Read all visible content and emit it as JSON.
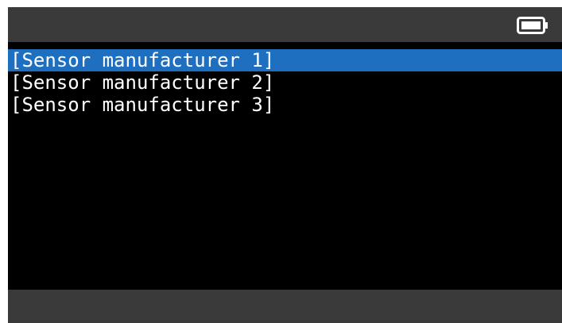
{
  "topbar": {
    "battery_icon": "battery-icon"
  },
  "list": {
    "items": [
      {
        "label": "[Sensor manufacturer 1]",
        "selected": true
      },
      {
        "label": "[Sensor manufacturer 2]",
        "selected": false
      },
      {
        "label": "[Sensor manufacturer 3]",
        "selected": false
      }
    ]
  },
  "colors": {
    "bar": "#3a3a3a",
    "screen": "#000000",
    "selection": "#1f6fc0",
    "text": "#ffffff"
  }
}
